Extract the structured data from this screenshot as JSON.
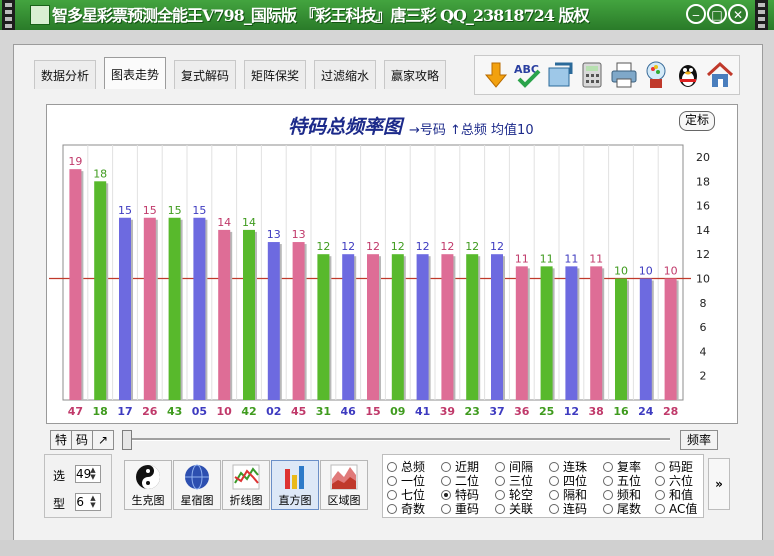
{
  "window": {
    "title": "智多星彩票预测全能王V798_国际版 『彩王科技』唐三彩 QQ_23818724 版权",
    "controls": [
      "minimize",
      "maximize",
      "close"
    ]
  },
  "tabs": [
    "数据分析",
    "图表走势",
    "复式解码",
    "矩阵保奖",
    "过滤缩水",
    "赢家攻略"
  ],
  "active_tab": "图表走势",
  "toolbar_icons": [
    "download-arrow-icon",
    "abc-spellcheck-icon",
    "export-icon",
    "calculator-icon",
    "printer-icon",
    "gumball-machine-icon",
    "qq-penguin-icon",
    "home-icon"
  ],
  "chart": {
    "setting_button": "定标",
    "legend": "→号码  ↑总频  均值10",
    "chart_data": {
      "type": "bar",
      "title": "特码总频率图",
      "categories": [
        "47",
        "18",
        "17",
        "26",
        "43",
        "05",
        "10",
        "42",
        "02",
        "45",
        "31",
        "46",
        "15",
        "09",
        "41",
        "39",
        "23",
        "37",
        "36",
        "25",
        "12",
        "38",
        "16",
        "24",
        "28"
      ],
      "values": [
        19,
        18,
        15,
        15,
        15,
        15,
        14,
        14,
        13,
        13,
        12,
        12,
        12,
        12,
        12,
        12,
        12,
        12,
        11,
        11,
        11,
        11,
        10,
        10,
        10
      ],
      "colors": [
        "pink",
        "green",
        "blue",
        "pink",
        "green",
        "blue",
        "pink",
        "green",
        "blue",
        "pink",
        "green",
        "blue",
        "pink",
        "green",
        "blue",
        "pink",
        "green",
        "blue",
        "pink",
        "green",
        "blue",
        "pink",
        "green",
        "blue",
        "pink"
      ],
      "mean": 10,
      "ylim": [
        0,
        20
      ],
      "yticks": [
        2,
        4,
        6,
        8,
        10,
        12,
        14,
        16,
        18,
        20
      ],
      "palette": {
        "pink": "#de6d96",
        "green": "#58b92c",
        "blue": "#6d6ae0",
        "mean_line": "#c0392b",
        "label_pink": "#c0396a",
        "label_green": "#3f9b1e",
        "label_blue": "#3e3bc0"
      }
    }
  },
  "slider": {
    "left_buttons": [
      "特",
      "码",
      "↗"
    ],
    "right_button": "频率"
  },
  "spinners": [
    {
      "label": "选",
      "value": "49"
    },
    {
      "label": "型",
      "value": "6"
    }
  ],
  "view_buttons": [
    {
      "label": "生克图",
      "icon": "yin-yang-icon",
      "active": false
    },
    {
      "label": "星宿图",
      "icon": "globe-icon",
      "active": false
    },
    {
      "label": "折线图",
      "icon": "line-chart-icon",
      "active": false
    },
    {
      "label": "直方图",
      "icon": "bar-chart-icon",
      "active": true
    },
    {
      "label": "区域图",
      "icon": "area-chart-icon",
      "active": false
    }
  ],
  "radios": [
    [
      "总频",
      "一位",
      "七位",
      "奇数"
    ],
    [
      "近期",
      "二位",
      "特码",
      "重码"
    ],
    [
      "间隔",
      "三位",
      "轮空",
      "关联"
    ],
    [
      "连珠",
      "四位",
      "隔和",
      "连码"
    ],
    [
      "复率",
      "五位",
      "频和",
      "尾数"
    ],
    [
      "码距",
      "六位",
      "和值",
      "AC值"
    ]
  ],
  "selected_radio": "特码",
  "more_button": "»"
}
